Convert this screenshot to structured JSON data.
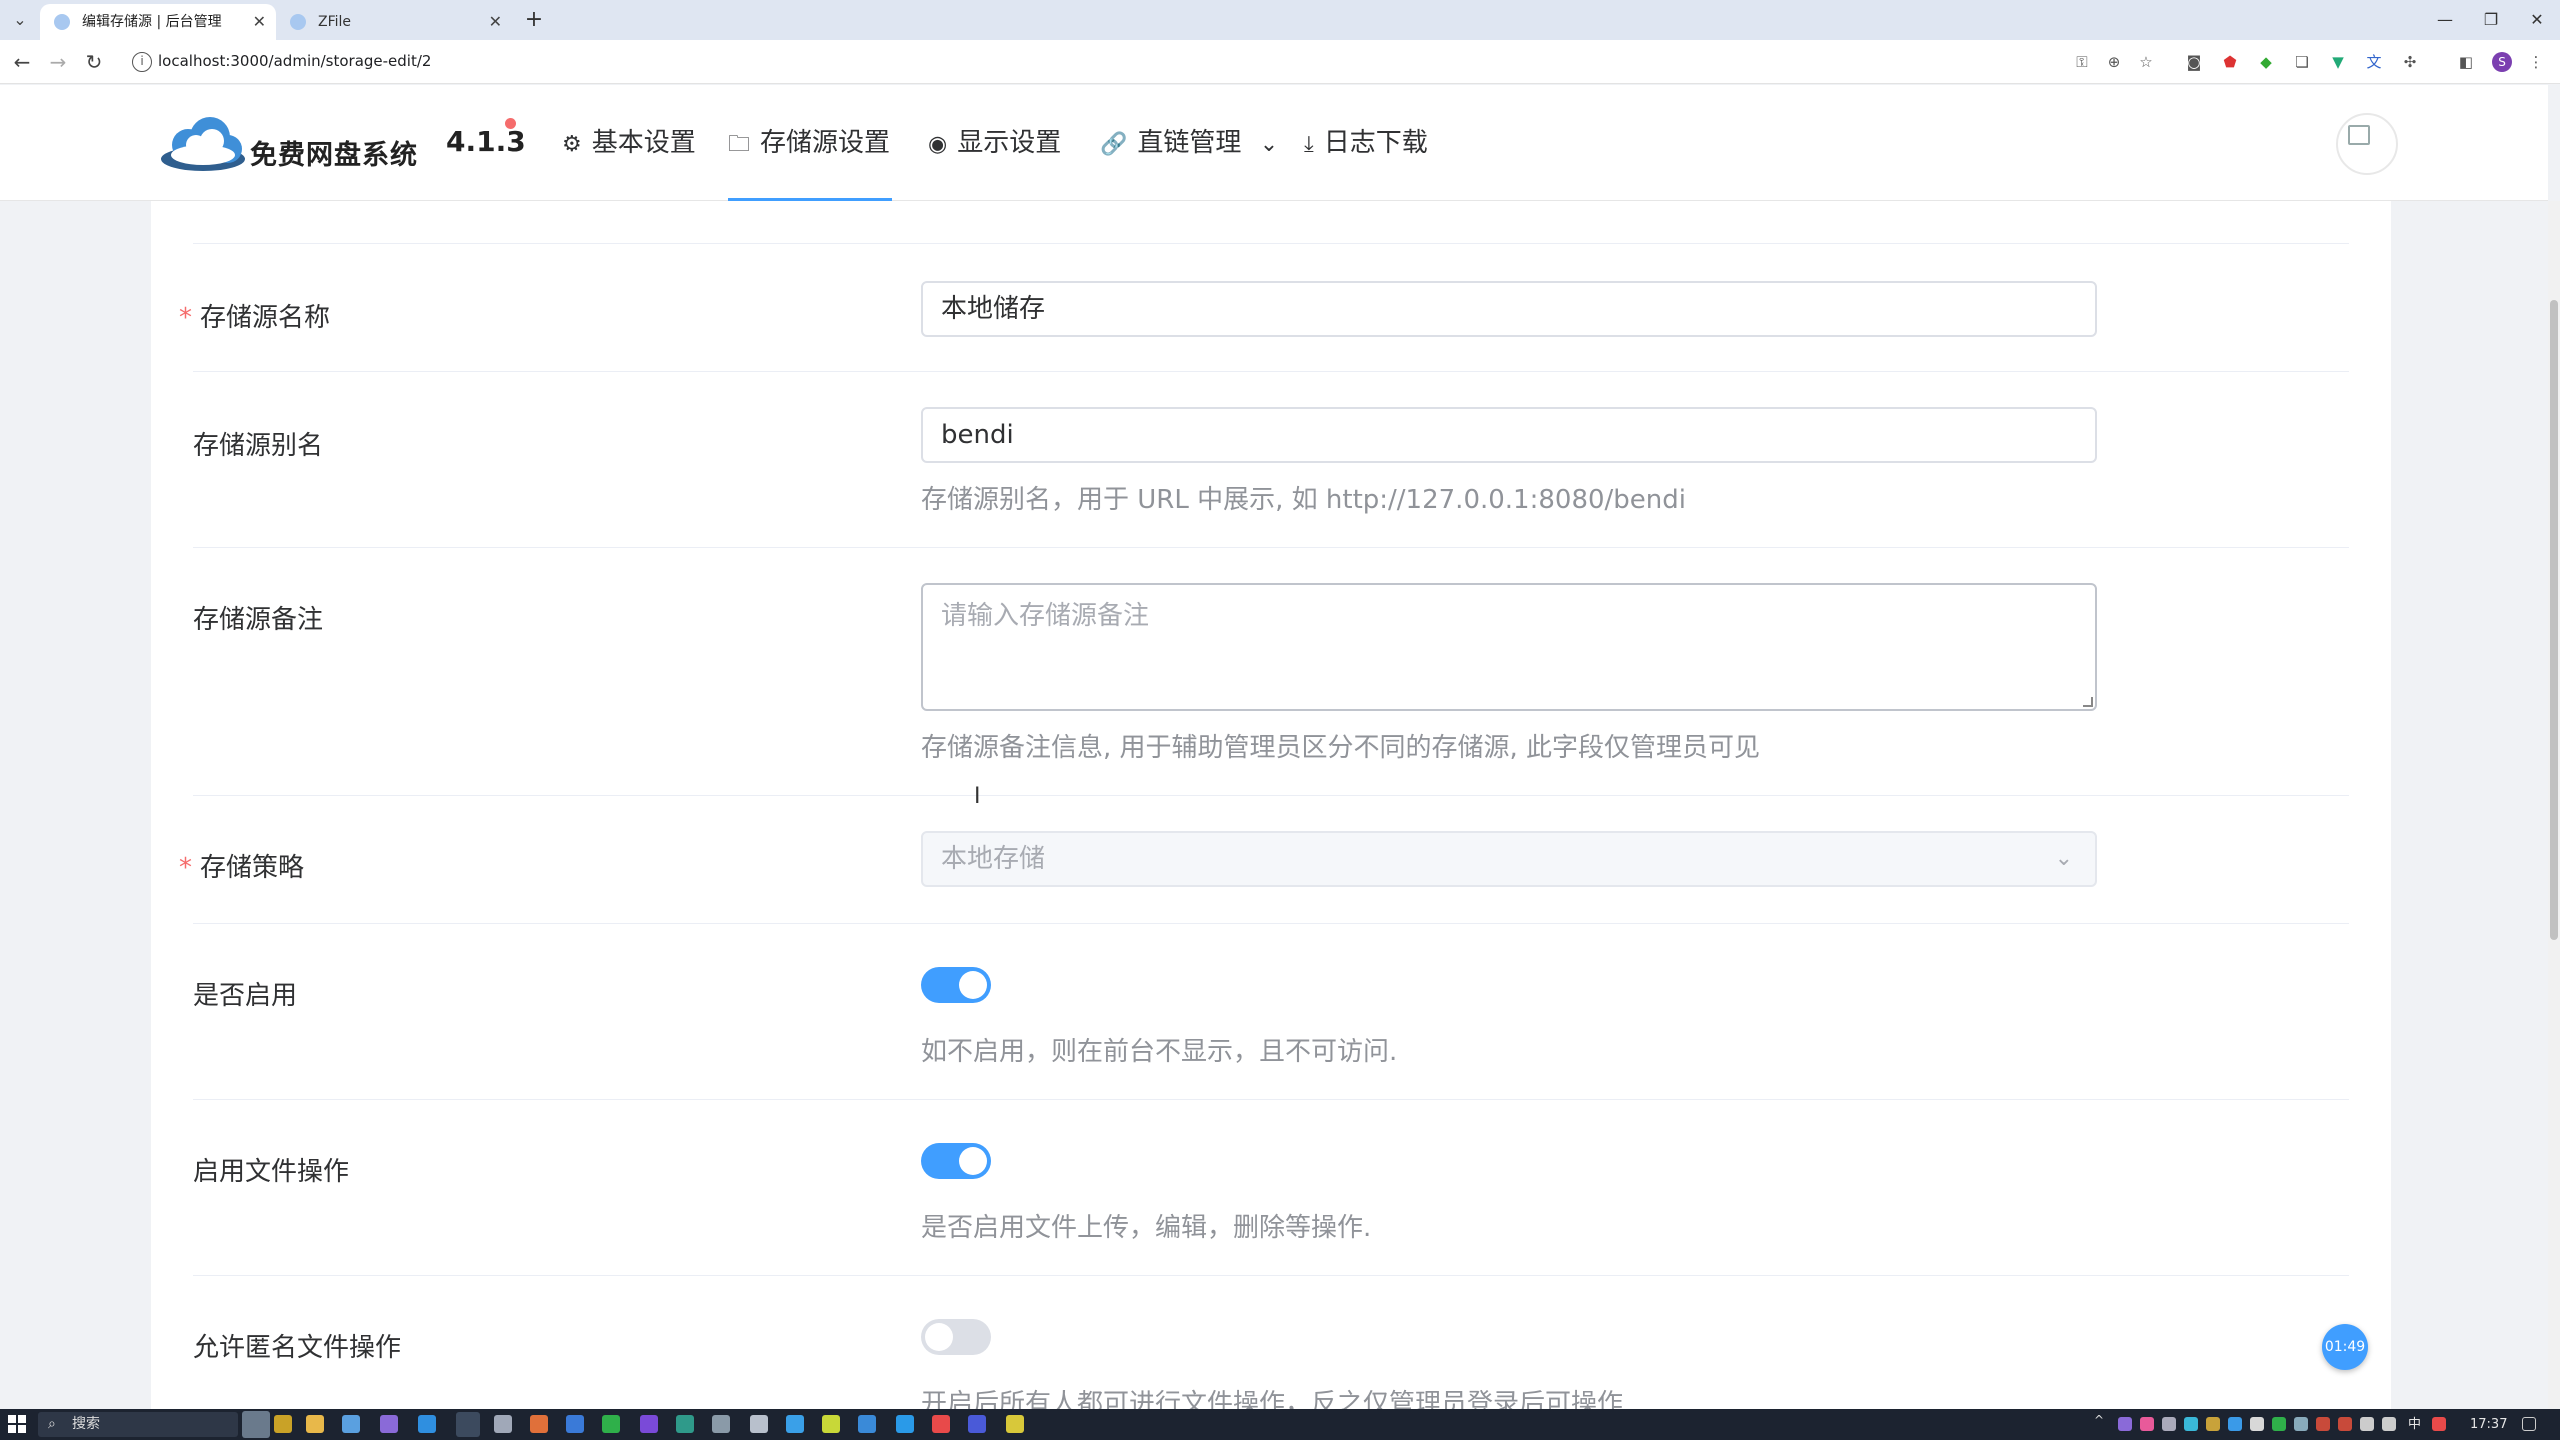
{
  "browser": {
    "tabs": [
      {
        "title": "编辑存储源 | 后台管理"
      },
      {
        "title": "ZFile"
      }
    ],
    "url": "localhost:3000/admin/storage-edit/2"
  },
  "header": {
    "app_name": "免费网盘系统",
    "version": "4.1.3",
    "menu": [
      {
        "label": "基本设置",
        "icon": "gear-icon"
      },
      {
        "label": "存储源设置",
        "icon": "folder-icon"
      },
      {
        "label": "显示设置",
        "icon": "eye-icon"
      },
      {
        "label": "直链管理",
        "icon": "link-icon"
      },
      {
        "label": "日志下载",
        "icon": "download-icon"
      }
    ]
  },
  "form": {
    "name": {
      "label": "存储源名称",
      "value": "本地储存"
    },
    "key": {
      "label": "存储源别名",
      "value": "bendi",
      "help": "存储源别名，用于 URL 中展示, 如 http://127.0.0.1:8080/bendi"
    },
    "remark": {
      "label": "存储源备注",
      "placeholder": "请输入存储源备注",
      "help": "存储源备注信息, 用于辅助管理员区分不同的存储源, 此字段仅管理员可见"
    },
    "type": {
      "label": "存储策略",
      "value": "本地存储"
    },
    "enable": {
      "label": "是否启用",
      "on": true,
      "help": "如不启用，则在前台不显示，且不可访问."
    },
    "enable_file_op": {
      "label": "启用文件操作",
      "on": true,
      "help": "是否启用文件上传，编辑，删除等操作."
    },
    "anon_file_op": {
      "label": "允许匿名文件操作",
      "on": false,
      "help": "开启后所有人都可进行文件操作，反之仅管理员登录后可操作"
    }
  },
  "timer_badge": "01:49",
  "taskbar": {
    "search_placeholder": "搜索",
    "ime": "中",
    "time": "17:37"
  },
  "colors": {
    "primary": "#409eff",
    "required": "#f56c6c",
    "help_text": "#909399"
  }
}
